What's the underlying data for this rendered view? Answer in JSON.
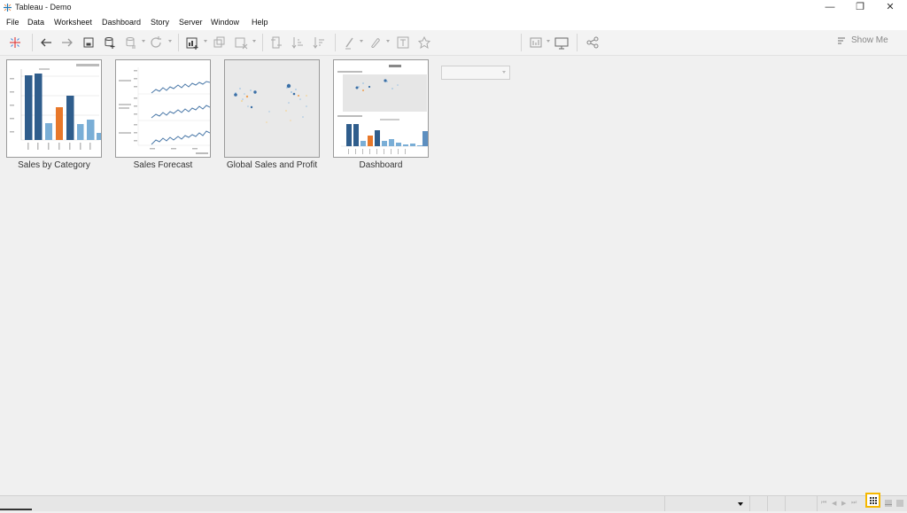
{
  "window": {
    "title": "Tableau - Demo",
    "app_icon": "tableau-logo-icon",
    "controls": [
      "minimize-icon",
      "restore-icon",
      "close-icon"
    ],
    "control_glyphs": {
      "minimize": "—",
      "restore": "❐",
      "close": "✕"
    }
  },
  "menu": {
    "items": [
      "File",
      "Data",
      "Worksheet",
      "Dashboard",
      "Story",
      "Server",
      "Window",
      "Help"
    ]
  },
  "toolbar": {
    "icons": [
      "tableau-start-icon",
      "undo-icon",
      "redo-icon",
      "save-icon",
      "new-data-source-icon",
      "pause-updates-icon",
      "refresh-icon",
      "new-worksheet-icon",
      "duplicate-icon",
      "clear-sheet-icon",
      "swap-axes-icon",
      "sort-ascending-icon",
      "sort-descending-icon",
      "highlight-icon",
      "group-icon",
      "labels-icon",
      "pin-icon",
      "fit-icon",
      "presentation-icon",
      "share-icon"
    ],
    "fit_value": "",
    "show_me_label": "Show Me"
  },
  "sheets": [
    {
      "label": "Sales by Category",
      "kind": "bar"
    },
    {
      "label": "Sales Forecast",
      "kind": "line"
    },
    {
      "label": "Global Sales and Profit",
      "kind": "map"
    },
    {
      "label": "Dashboard",
      "kind": "dashboard"
    }
  ],
  "status": {
    "view_buttons": [
      "sheet-sorter-icon",
      "filmstrip-icon",
      "tabs-icon"
    ],
    "active_view": "sheet-sorter",
    "nav_buttons": [
      "first-sheet-icon",
      "previous-sheet-icon",
      "next-sheet-icon",
      "last-sheet-icon"
    ]
  },
  "colors": {
    "accent_highlight": "#f5b800",
    "bar_dark_blue": "#2f5d8c",
    "bar_orange": "#e8782a",
    "bar_light_blue": "#7aaed6",
    "map_background": "#e9e9e9"
  }
}
